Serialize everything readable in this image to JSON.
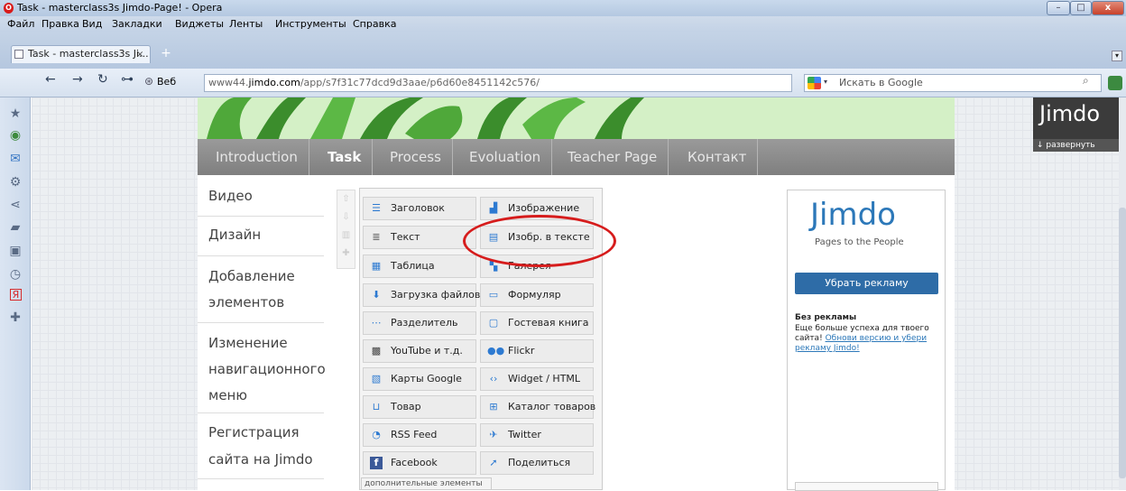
{
  "window": {
    "title": "Task - masterclass3s Jimdo-Page! - Opera",
    "min_label": "–",
    "max_label": "□",
    "close_label": "x"
  },
  "menu": [
    "Файл",
    "Правка",
    "Вид",
    "Закладки",
    "Виджеты",
    "Ленты",
    "Инструменты",
    "Справка"
  ],
  "tab": {
    "label": "Task - masterclass3s Ji...",
    "close": "×",
    "new_tab": "+"
  },
  "addressbar": {
    "back": "←",
    "forward": "→",
    "reload": "↻",
    "key": "⊶",
    "web_label": "Веб",
    "url_prefix": "www44.",
    "url_domain": "jimdo.com",
    "url_path": "/app/s7f31c77dcd9d3aae/p6d60e8451142c576/",
    "search_placeholder": "Искать в Google",
    "search_icon": "⌕"
  },
  "side_icons": [
    "star-icon",
    "globe-icon",
    "mail-icon",
    "gear-icon",
    "share-icon",
    "notes-icon",
    "download-icon",
    "clock-icon",
    "yandex-icon",
    "plus-icon"
  ],
  "site": {
    "nav": [
      "Introduction",
      "Task",
      "Process",
      "Evoluation",
      "Teacher Page",
      "Контакт"
    ],
    "active_nav": "Task",
    "subnav": {
      "video": "Видео",
      "design": "Дизайн",
      "add1": "Добавление",
      "add2": "элементов",
      "nav1": "Изменение",
      "nav2": "навигационного",
      "nav3": "меню",
      "reg1": "Регистрация",
      "reg2": "сайта на Jimdo"
    },
    "elements": {
      "heading": "Заголовок",
      "image": "Изображение",
      "text": "Текст",
      "image_text": "Изобр. в тексте",
      "table": "Таблица",
      "gallery": "Галерея",
      "upload": "Загрузка файлов",
      "form": "Формуляр",
      "divider": "Разделитель",
      "guestbook": "Гостевая книга",
      "youtube": "YouTube и т.д.",
      "flickr": "Flickr",
      "maps": "Карты Google",
      "widget": "Widget / HTML",
      "product": "Товар",
      "catalog": "Каталог товаров",
      "rss": "RSS Feed",
      "twitter": "Twitter",
      "facebook": "Facebook",
      "share": "Поделиться",
      "more": "дополнительные элементы"
    }
  },
  "ad": {
    "logo": "Jimdo",
    "tagline": "Pages to the People",
    "button": "Убрать рекламу",
    "heading": "Без рекламы",
    "text": "Еще больше успеха для твоего сайта!",
    "link": "Обнови версию и убери рекламу Jimdo!"
  },
  "jimdo_bar": {
    "logo": "Jimdo",
    "expand": "↓ развернуть"
  },
  "colors": {
    "highlight_ellipse": "#d61c1c",
    "nav_bg": "#8c8c8c",
    "header_green": "#d4f0c6",
    "ad_button": "#2e6ca7"
  }
}
